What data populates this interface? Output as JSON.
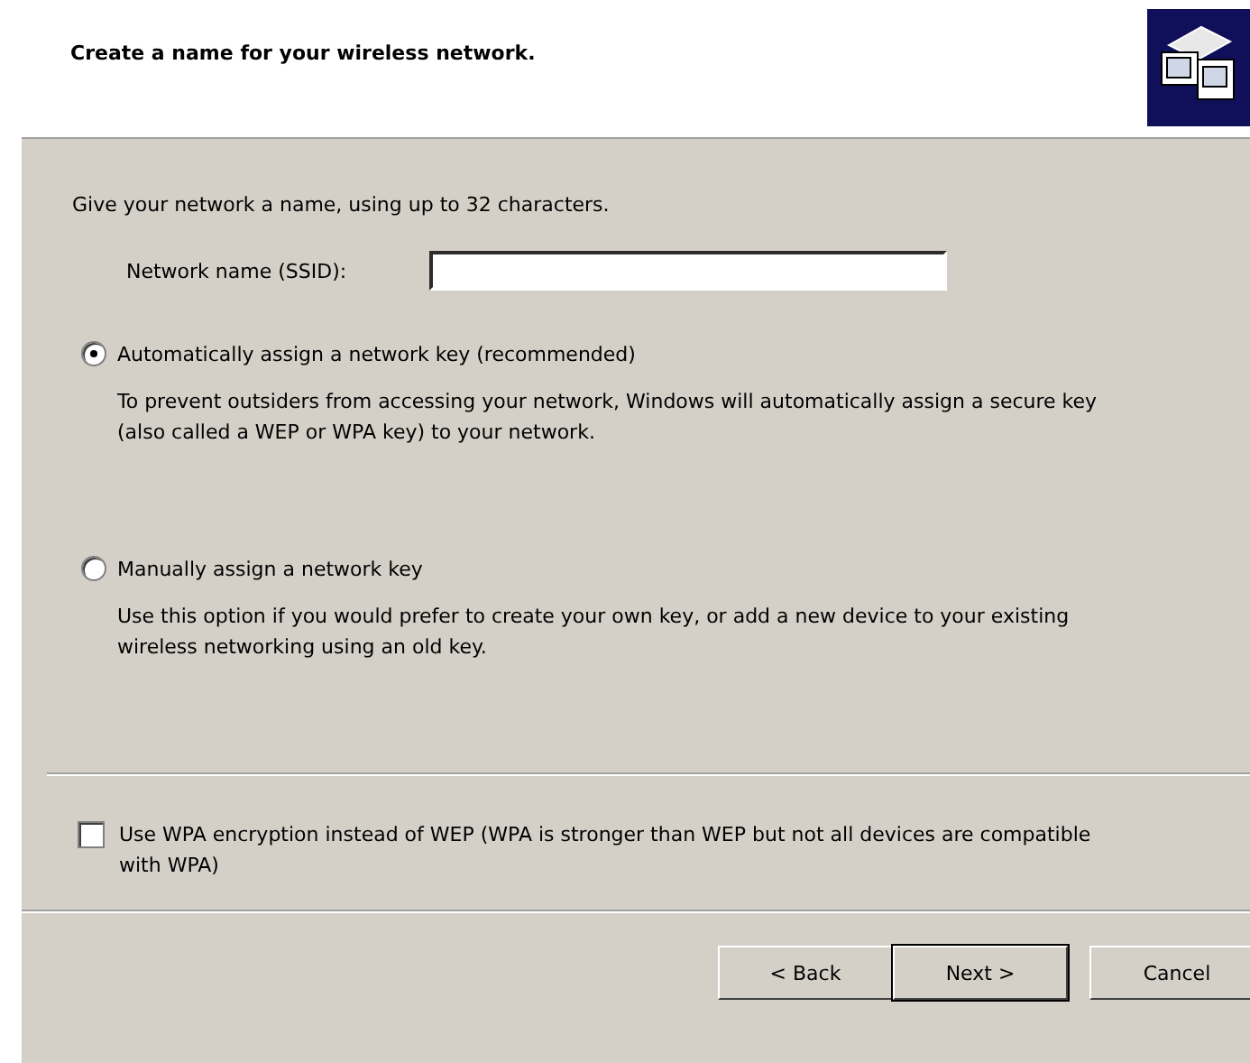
{
  "header": {
    "title": "Create a name for your wireless network."
  },
  "intro": "Give your network a name, using up to 32 characters.",
  "ssid_field": {
    "label": "Network name (SSID):"
  },
  "key_options": [
    {
      "label": "Automatically assign a network key (recommended)",
      "selected": true,
      "description": "To prevent outsiders from accessing your network, Windows will automatically assign a secure key (also called a WEP or WPA key) to your network."
    },
    {
      "label": "Manually assign a network key",
      "selected": false,
      "description": "Use this option if you would prefer to create your own key, or add a new device to your existing wireless networking using an old key."
    }
  ],
  "wpa_option": {
    "label": "Use WPA encryption instead of WEP (WPA is stronger than WEP but not all devices are compatible with WPA)",
    "checked": false
  },
  "buttons": [
    {
      "label": "< Back",
      "default": false
    },
    {
      "label": "Next >",
      "default": true
    },
    {
      "label": "Cancel",
      "default": false
    }
  ]
}
